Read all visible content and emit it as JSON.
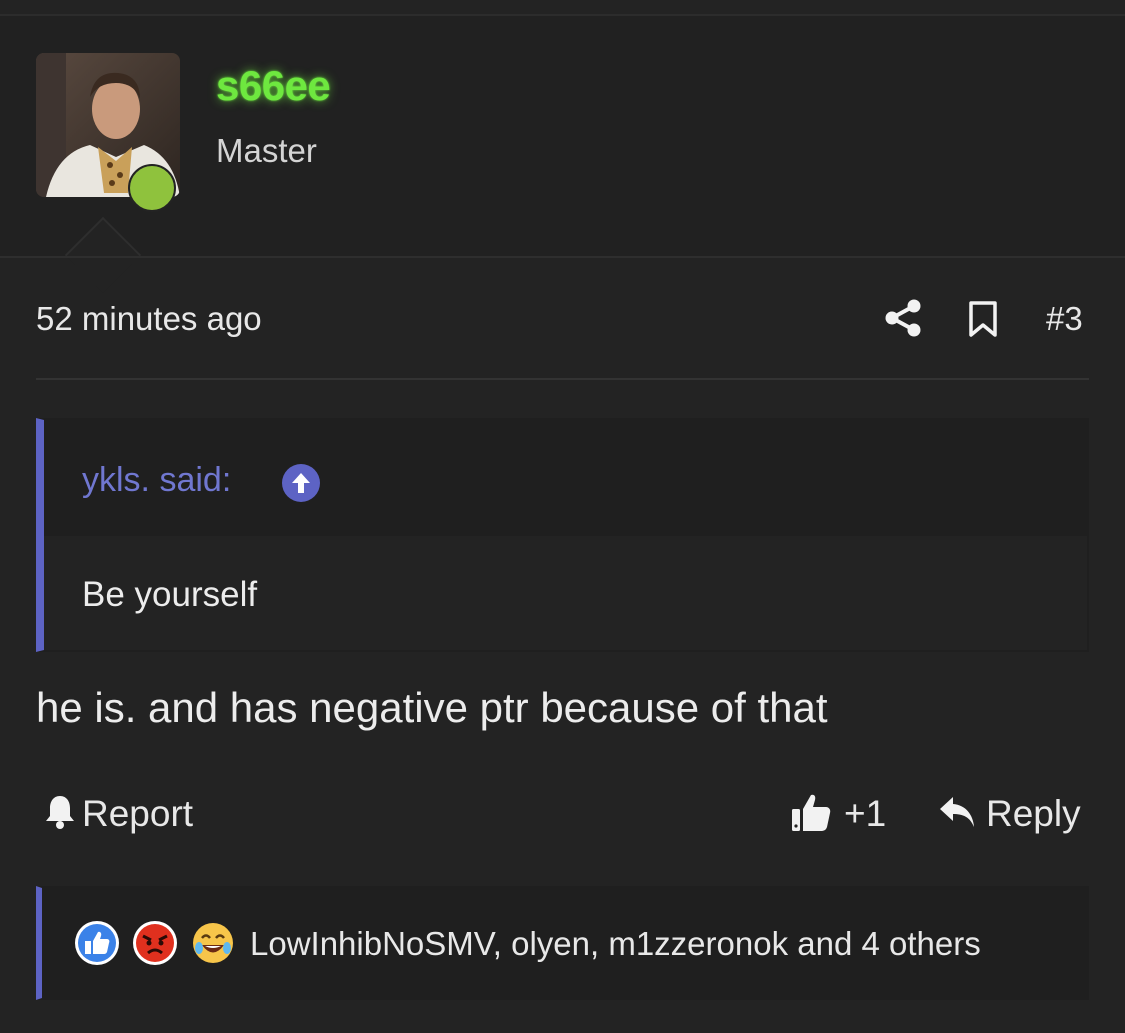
{
  "user": {
    "name": "s66ee",
    "title": "Master",
    "avatar_icon": "user-avatar",
    "online_color": "#8fc23d",
    "name_color": "#6ee83f"
  },
  "post": {
    "timestamp": "52 minutes ago",
    "number": "#3",
    "share_icon": "share-icon",
    "bookmark_icon": "bookmark-icon"
  },
  "quote": {
    "author": "ykls. said:",
    "jump_icon": "arrow-up-circle-icon",
    "text": "Be yourself"
  },
  "message": "he is. and has negative ptr because of that",
  "actions": {
    "report_label": "Report",
    "like_label": "+1",
    "reply_label": "Reply"
  },
  "reactions": {
    "icons": [
      "like-reaction-icon",
      "angry-reaction-icon",
      "laughing-reaction-icon"
    ],
    "summary": "LowInhibNoSMV, olyen, m1zzeronok and 4 others"
  },
  "colors": {
    "accent": "#5d63c4",
    "background": "#232323"
  }
}
